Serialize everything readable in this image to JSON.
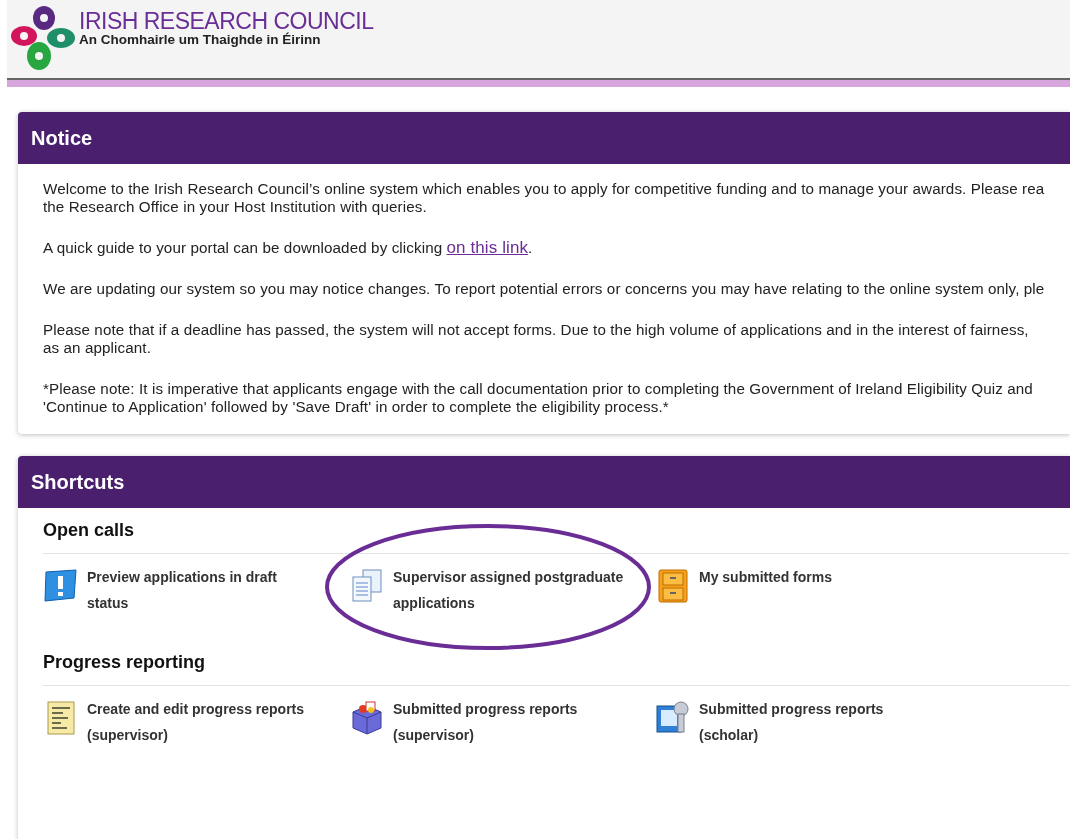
{
  "header": {
    "logo_title": "IRISH RESEARCH COUNCIL",
    "logo_subtitle": "An Chomhairle um Thaighde in Éirinn"
  },
  "notice": {
    "title": "Notice",
    "paragraphs": [
      {
        "lines": [
          "Welcome to the Irish Research Council’s online system which enables you to apply for competitive funding and to manage your awards. Please rea",
          "the Research Office in your Host Institution with queries."
        ]
      },
      {
        "lines": [
          "A quick guide to your portal can be downloaded by clicking "
        ],
        "link": "on this link",
        "after": "."
      },
      {
        "lines": [
          "We are updating our system so you may notice changes. To report potential errors or concerns you may have relating to the online system only, ple"
        ]
      },
      {
        "lines": [
          "Please note that if a deadline has passed, the system will not accept forms. Due to the high volume of applications and in the interest of fairness,",
          "as an applicant."
        ]
      },
      {
        "lines": [
          "*Please note: It is imperative that applicants engage with the call documentation prior to completing the Government of Ireland Eligibility Quiz and",
          "'Continue to Application' followed by 'Save Draft' in order to complete the eligibility process.*"
        ]
      }
    ]
  },
  "shortcuts": {
    "title": "Shortcuts",
    "sections": [
      {
        "heading": "Open calls",
        "items": [
          {
            "kind": "alert",
            "label": "Preview applications in draft status",
            "highlighted": false
          },
          {
            "kind": "documents",
            "label": "Supervisor assigned postgraduate applications",
            "highlighted": true
          },
          {
            "kind": "cabinet",
            "label": "My submitted forms",
            "highlighted": false
          }
        ]
      },
      {
        "heading": "Progress reporting",
        "items": [
          {
            "kind": "report",
            "label": "Create and edit progress reports (supervisor)",
            "highlighted": false
          },
          {
            "kind": "box",
            "label": "Submitted progress reports (supervisor)",
            "highlighted": false
          },
          {
            "kind": "keys",
            "label": "Submitted progress reports (scholar)",
            "highlighted": false
          }
        ]
      }
    ]
  }
}
